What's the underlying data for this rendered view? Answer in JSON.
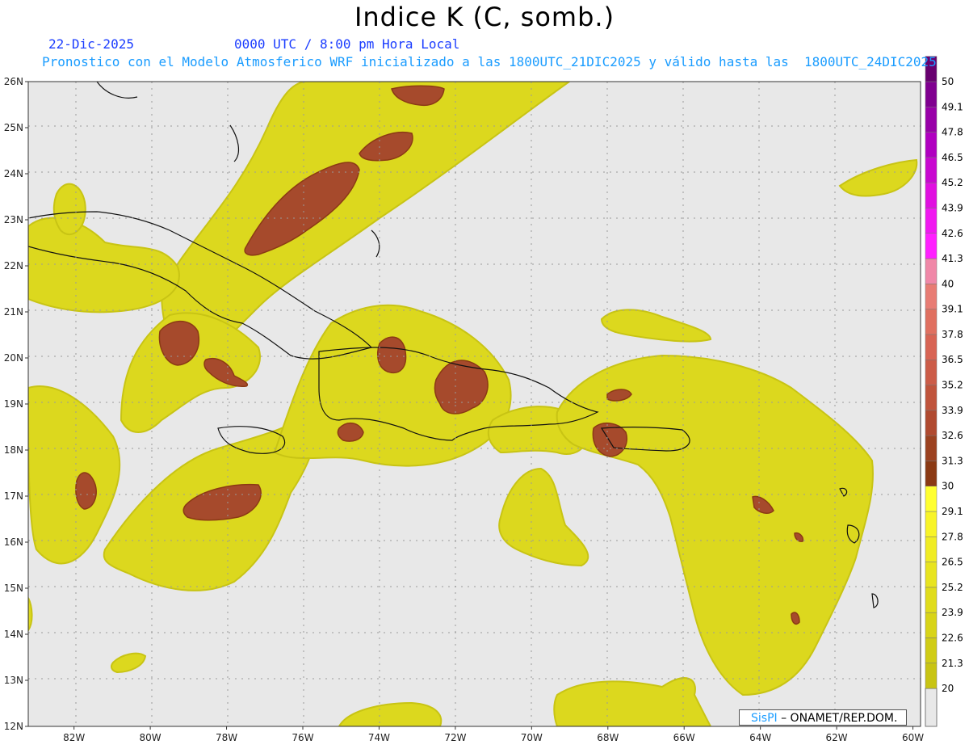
{
  "header": {
    "title": "Indice K (C, somb.)",
    "date": "22-Dic-2025",
    "time": "0000 UTC / 8:00 pm Hora Local",
    "subtitle": "Pronostico con el Modelo Atmosferico WRF inicializado a las 1800UTC_21DIC2025 y válido hasta las  1800UTC_24DIC2025"
  },
  "map": {
    "lon_range": [
      -83.2,
      -59.8
    ],
    "lat_range": [
      12,
      26
    ],
    "lat_ticks": [
      "12N",
      "13N",
      "14N",
      "15N",
      "16N",
      "17N",
      "18N",
      "19N",
      "20N",
      "21N",
      "22N",
      "23N",
      "24N",
      "25N",
      "26N"
    ],
    "lon_ticks": [
      "82W",
      "80W",
      "78W",
      "76W",
      "74W",
      "72W",
      "70W",
      "68W",
      "66W",
      "64W",
      "62W",
      "60W"
    ],
    "background_color": "#e8e8e8",
    "grid": true
  },
  "colorbar": {
    "labels": [
      "20",
      "21.3",
      "22.6",
      "23.9",
      "25.2",
      "26.5",
      "27.8",
      "29.1",
      "30",
      "31.3",
      "32.6",
      "33.9",
      "35.2",
      "36.5",
      "37.8",
      "39.1",
      "40",
      "41.3",
      "42.6",
      "43.9",
      "45.2",
      "46.5",
      "47.8",
      "49.1",
      "50"
    ],
    "colors": [
      "#c8c414",
      "#d0cc16",
      "#d8d418",
      "#e0dc1c",
      "#e8e420",
      "#f0ec24",
      "#f8f428",
      "#ffff30",
      "#8b3a14",
      "#9c4220",
      "#b04a30",
      "#c0543c",
      "#cc5c48",
      "#d86454",
      "#e07060",
      "#e87c74",
      "#f088a8",
      "#ff20ff",
      "#f018f0",
      "#e010e0",
      "#c808d0",
      "#b000c0",
      "#9800a8",
      "#800090",
      "#680070"
    ]
  },
  "credit": {
    "brand": "SisPI",
    "text": "– ONAMET/REP.DOM."
  }
}
